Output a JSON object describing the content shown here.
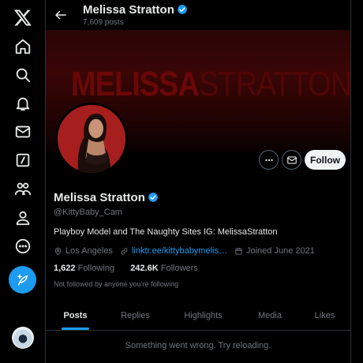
{
  "header": {
    "name": "Melissa Stratton",
    "post_count": "7,609 posts"
  },
  "banner": {
    "text_bold": "MELISSA",
    "text_light": "STRATTON.COM"
  },
  "profile": {
    "name": "Melissa Stratton",
    "handle": "@KittyBaby_Cam",
    "bio": "Playboy Model and The Naughty Sites  IG: MelissaStratton",
    "location": "Los Angeles",
    "link": "linktr.ee/kittybabymelis…",
    "joined": "Joined June 2021",
    "following_count": "1,622",
    "following_label": "Following",
    "followers_count": "242.6K",
    "followers_label": "Followers",
    "not_followed": "Not followed by anyone you’re following"
  },
  "actions": {
    "follow_label": "Follow"
  },
  "tabs": [
    {
      "label": "Posts"
    },
    {
      "label": "Replies"
    },
    {
      "label": "Highlights"
    },
    {
      "label": "Media"
    },
    {
      "label": "Likes"
    }
  ],
  "feed": {
    "error": "Something went wrong. Try reloading."
  },
  "sidebar": {
    "icons": [
      "x-logo-icon",
      "home-icon",
      "search-icon",
      "bell-icon",
      "mail-icon",
      "grok-icon",
      "communities-icon",
      "profile-icon",
      "more-icon",
      "compose-icon"
    ]
  },
  "colors": {
    "accent": "#1d9bf0",
    "background": "#000000",
    "text": "#e7e9ea",
    "muted": "#71767b",
    "banner_red": "#6a0707"
  }
}
